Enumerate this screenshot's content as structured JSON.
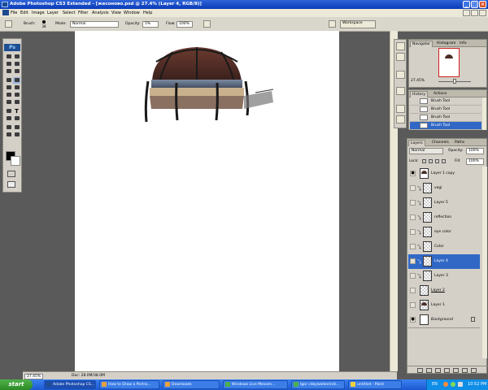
{
  "window": {
    "title": "Adobe Photoshop CS3 Extended - [жесоново.psd @ 27.4% (Layer 4, RGB/8)]"
  },
  "menu": [
    "File",
    "Edit",
    "Image",
    "Layer",
    "Select",
    "Filter",
    "Analysis",
    "View",
    "Window",
    "Help"
  ],
  "options": {
    "brush_label": "Brush:",
    "brush_size": "38",
    "mode_label": "Mode:",
    "mode_value": "Normal",
    "opacity_label": "Opacity:",
    "opacity_value": "5%",
    "flow_label": "Flow:",
    "flow_value": "100%",
    "workspace_label": "Workspace"
  },
  "toolbox": {
    "logo": "Ps"
  },
  "navigator": {
    "tabs": [
      "Navigator",
      "Histogram",
      "Info"
    ],
    "zoom_value": "27.45%"
  },
  "history": {
    "tabs": [
      "History",
      "Actions"
    ],
    "items": [
      {
        "label": "Brush Tool",
        "selected": false
      },
      {
        "label": "Brush Tool",
        "selected": false
      },
      {
        "label": "Brush Tool",
        "selected": false
      },
      {
        "label": "Brush Tool",
        "selected": true
      }
    ]
  },
  "layers": {
    "tabs": [
      "Layers",
      "Channels",
      "Paths"
    ],
    "blend_mode": "Normal",
    "opacity_label": "Opacity:",
    "opacity_value": "100%",
    "lock_label": "Lock:",
    "fill_label": "Fill:",
    "fill_value": "100%",
    "rows": [
      {
        "name": "Layer 1 copy",
        "visible": true,
        "clipped": false,
        "thumb": "dome",
        "selected": false
      },
      {
        "name": "vegi",
        "visible": false,
        "clipped": true,
        "thumb": "checker",
        "selected": false
      },
      {
        "name": "Layer 5",
        "visible": false,
        "clipped": true,
        "thumb": "checker",
        "selected": false
      },
      {
        "name": "reflection",
        "visible": false,
        "clipped": true,
        "thumb": "checker",
        "selected": false
      },
      {
        "name": "eye color",
        "visible": false,
        "clipped": true,
        "thumb": "checker",
        "selected": false
      },
      {
        "name": "Color",
        "visible": false,
        "clipped": true,
        "thumb": "checker",
        "selected": false
      },
      {
        "name": "Layer 4",
        "visible": false,
        "clipped": true,
        "thumb": "checker",
        "selected": true
      },
      {
        "name": "Layer 3",
        "visible": false,
        "clipped": true,
        "thumb": "checker",
        "selected": false
      },
      {
        "name": "Layer 2",
        "visible": false,
        "clipped": false,
        "thumb": "checker",
        "selected": false
      },
      {
        "name": "Layer 1",
        "visible": false,
        "clipped": false,
        "thumb": "dome",
        "selected": false
      },
      {
        "name": "Background",
        "visible": true,
        "clipped": false,
        "thumb": "white",
        "selected": false,
        "locked": true
      }
    ]
  },
  "status": {
    "zoom": "27.45%",
    "doc": "Doc: 28.0M/38.0M"
  },
  "taskbar": {
    "start_label": "start",
    "tasks": [
      {
        "label": "Adobe Photoshop CS...",
        "active": true
      },
      {
        "label": "How to Draw a Portra...",
        "active": false
      },
      {
        "label": "Downloads",
        "active": false
      },
      {
        "label": "Windows Live Messen...",
        "active": false
      },
      {
        "label": "Igor  cdaywalkerindi...",
        "active": false
      },
      {
        "label": "untitled - Paint",
        "active": false
      }
    ],
    "tray_lang": "EN",
    "clock": "10:52 PM"
  },
  "colors": {
    "titlebar": "#0b3bb8",
    "selection": "#3168c6",
    "taskbar": "#245edb",
    "start": "#2d8a26"
  }
}
